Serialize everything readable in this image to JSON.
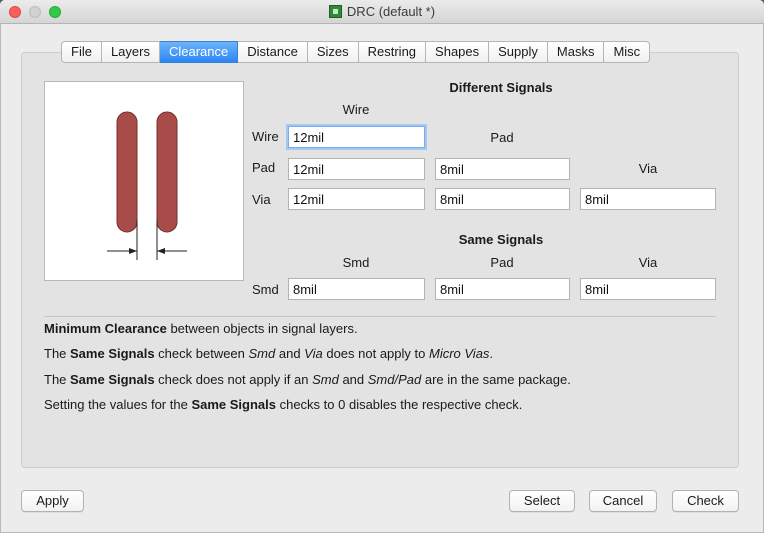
{
  "window": {
    "title": "DRC (default *)"
  },
  "tabs": [
    "File",
    "Layers",
    "Clearance",
    "Distance",
    "Sizes",
    "Restring",
    "Shapes",
    "Supply",
    "Masks",
    "Misc"
  ],
  "active_tab": "Clearance",
  "different_signals": {
    "heading": "Different Signals",
    "col_wire": "Wire",
    "col_pad": "Pad",
    "col_via": "Via",
    "row_wire": "Wire",
    "row_pad": "Pad",
    "row_via": "Via",
    "wire_wire": "12mil",
    "pad_wire": "12mil",
    "pad_pad": "8mil",
    "via_wire": "12mil",
    "via_pad": "8mil",
    "via_via": "8mil"
  },
  "same_signals": {
    "heading": "Same Signals",
    "col_smd": "Smd",
    "col_pad": "Pad",
    "col_via": "Via",
    "row_smd": "Smd",
    "smd_smd": "8mil",
    "smd_pad": "8mil",
    "smd_via": "8mil"
  },
  "notes": {
    "line1_b": "Minimum Clearance",
    "line1_rest": " between objects in signal layers.",
    "line2_a": "The ",
    "line2_b": "Same Signals",
    "line2_c": " check between ",
    "line2_smd": "Smd",
    "line2_and": " and ",
    "line2_via": "Via",
    "line2_d": " does not apply to ",
    "line2_micro": "Micro Vias",
    "line2_end": ".",
    "line3_a": "The ",
    "line3_b": "Same Signals",
    "line3_c": " check does not apply if an ",
    "line3_smd": "Smd",
    "line3_and": " and ",
    "line3_smdpad": "Smd/Pad",
    "line3_end": " are in the same package.",
    "line4_a": "Setting the values for the ",
    "line4_b": "Same Signals",
    "line4_end": " checks to 0 disables the respective check."
  },
  "buttons": {
    "apply": "Apply",
    "select": "Select",
    "cancel": "Cancel",
    "check": "Check"
  },
  "colors": {
    "trace": "#a84c4a",
    "trace_border": "#7a2e2c",
    "accent": "#2b87f5"
  }
}
